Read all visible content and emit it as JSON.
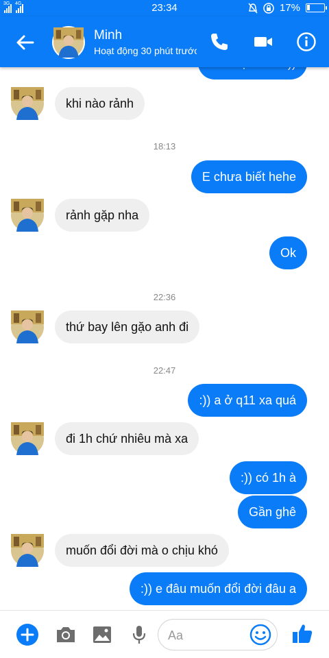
{
  "status_bar": {
    "signal_1": "3G",
    "signal_2": "4G",
    "time": "23:34",
    "battery_text": "17%",
    "battery_level": 0.17
  },
  "header": {
    "contact_name": "Minh",
    "contact_status": "Hoạt động 30 phút trước"
  },
  "messages": {
    "m0": "E đi học rồi a :))",
    "m1": "khi nào rảnh",
    "ts1": "18:13",
    "m2": "E chưa biết hehe",
    "m3": "rảnh gặp nha",
    "m4": "Ok",
    "ts2": "22:36",
    "m5": "thứ bay lên gặo anh đi",
    "ts3": "22:47",
    "m6": ":)) a ở q11 xa quá",
    "m7": "đi 1h chứ nhiêu mà xa",
    "m8": ":)) có 1h à",
    "m9": "Gần ghê",
    "m10": "muốn đổi đời mà o chịu khó",
    "m11": ":)) e đâu muốn đổi đời đâu a"
  },
  "composer": {
    "placeholder": "Aa"
  },
  "colors": {
    "accent": "#0a7cf7",
    "incoming_bubble": "#efeff0",
    "timestamp": "#888888"
  },
  "icons": [
    "back-arrow-icon",
    "phone-icon",
    "video-camera-icon",
    "info-icon",
    "add-icon",
    "camera-icon",
    "image-icon",
    "microphone-icon",
    "emoji-icon",
    "thumbs-up-icon"
  ]
}
